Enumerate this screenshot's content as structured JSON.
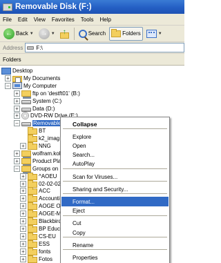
{
  "window": {
    "title": "Removable Disk (F:)"
  },
  "menubar": [
    "File",
    "Edit",
    "View",
    "Favorites",
    "Tools",
    "Help"
  ],
  "toolbar": {
    "back_label": "Back",
    "search_label": "Search",
    "folders_label": "Folders"
  },
  "address": {
    "label": "Address",
    "value": "F:\\"
  },
  "pane": {
    "title": "Folders"
  },
  "tree": [
    {
      "label": "Desktop",
      "icon": "desktop-icon"
    },
    {
      "label": "My Documents",
      "icon": "my-documents-icon"
    },
    {
      "label": "My Computer",
      "icon": "computer-icon"
    },
    {
      "label": "ftp on 'destft01' (B:)",
      "icon": "network-drive-icon"
    },
    {
      "label": "System (C:)",
      "icon": "drive-icon"
    },
    {
      "label": "Data (D:)",
      "icon": "drive-icon"
    },
    {
      "label": "DVD-RW Drive (E:)",
      "icon": "dvd-icon"
    },
    {
      "label": "Removable Disk (F:)",
      "icon": "drive-icon"
    },
    {
      "label": "BT",
      "icon": "folder-icon"
    },
    {
      "label": "k2_imag",
      "icon": "folder-icon"
    },
    {
      "label": "NNG",
      "icon": "folder-icon"
    },
    {
      "label": "wolfram.koh",
      "icon": "network-drive-icon"
    },
    {
      "label": "Product Plan",
      "icon": "network-drive-icon"
    },
    {
      "label": "Groups on 'i",
      "icon": "network-drive-icon"
    },
    {
      "label": "^AOEU",
      "icon": "folder-icon"
    },
    {
      "label": "02-02-02",
      "icon": "folder-icon"
    },
    {
      "label": "ACC",
      "icon": "folder-icon"
    },
    {
      "label": "Accounti",
      "icon": "folder-icon"
    },
    {
      "label": "AOGE OE",
      "icon": "folder-icon"
    },
    {
      "label": "AOGE-MI",
      "icon": "folder-icon"
    },
    {
      "label": "Blackbird",
      "icon": "folder-icon"
    },
    {
      "label": "BP Educa",
      "icon": "folder-icon"
    },
    {
      "label": "CS-EU",
      "icon": "folder-icon"
    },
    {
      "label": "ESS",
      "icon": "folder-icon"
    },
    {
      "label": "fonts",
      "icon": "folder-icon"
    },
    {
      "label": "Fotos",
      "icon": "folder-icon"
    }
  ],
  "context_menu": [
    {
      "label": "Collapse"
    },
    {
      "label": "Explore"
    },
    {
      "label": "Open"
    },
    {
      "label": "Search..."
    },
    {
      "label": "AutoPlay"
    },
    {
      "label": "Scan for Viruses..."
    },
    {
      "label": "Sharing and Security..."
    },
    {
      "label": "Format..."
    },
    {
      "label": "Eject"
    },
    {
      "label": "Cut"
    },
    {
      "label": "Copy"
    },
    {
      "label": "Rename"
    },
    {
      "label": "Properties"
    }
  ],
  "colors": {
    "titlebar": "#245fc4",
    "selection": "#316ac5",
    "chrome": "#ece9d8"
  }
}
